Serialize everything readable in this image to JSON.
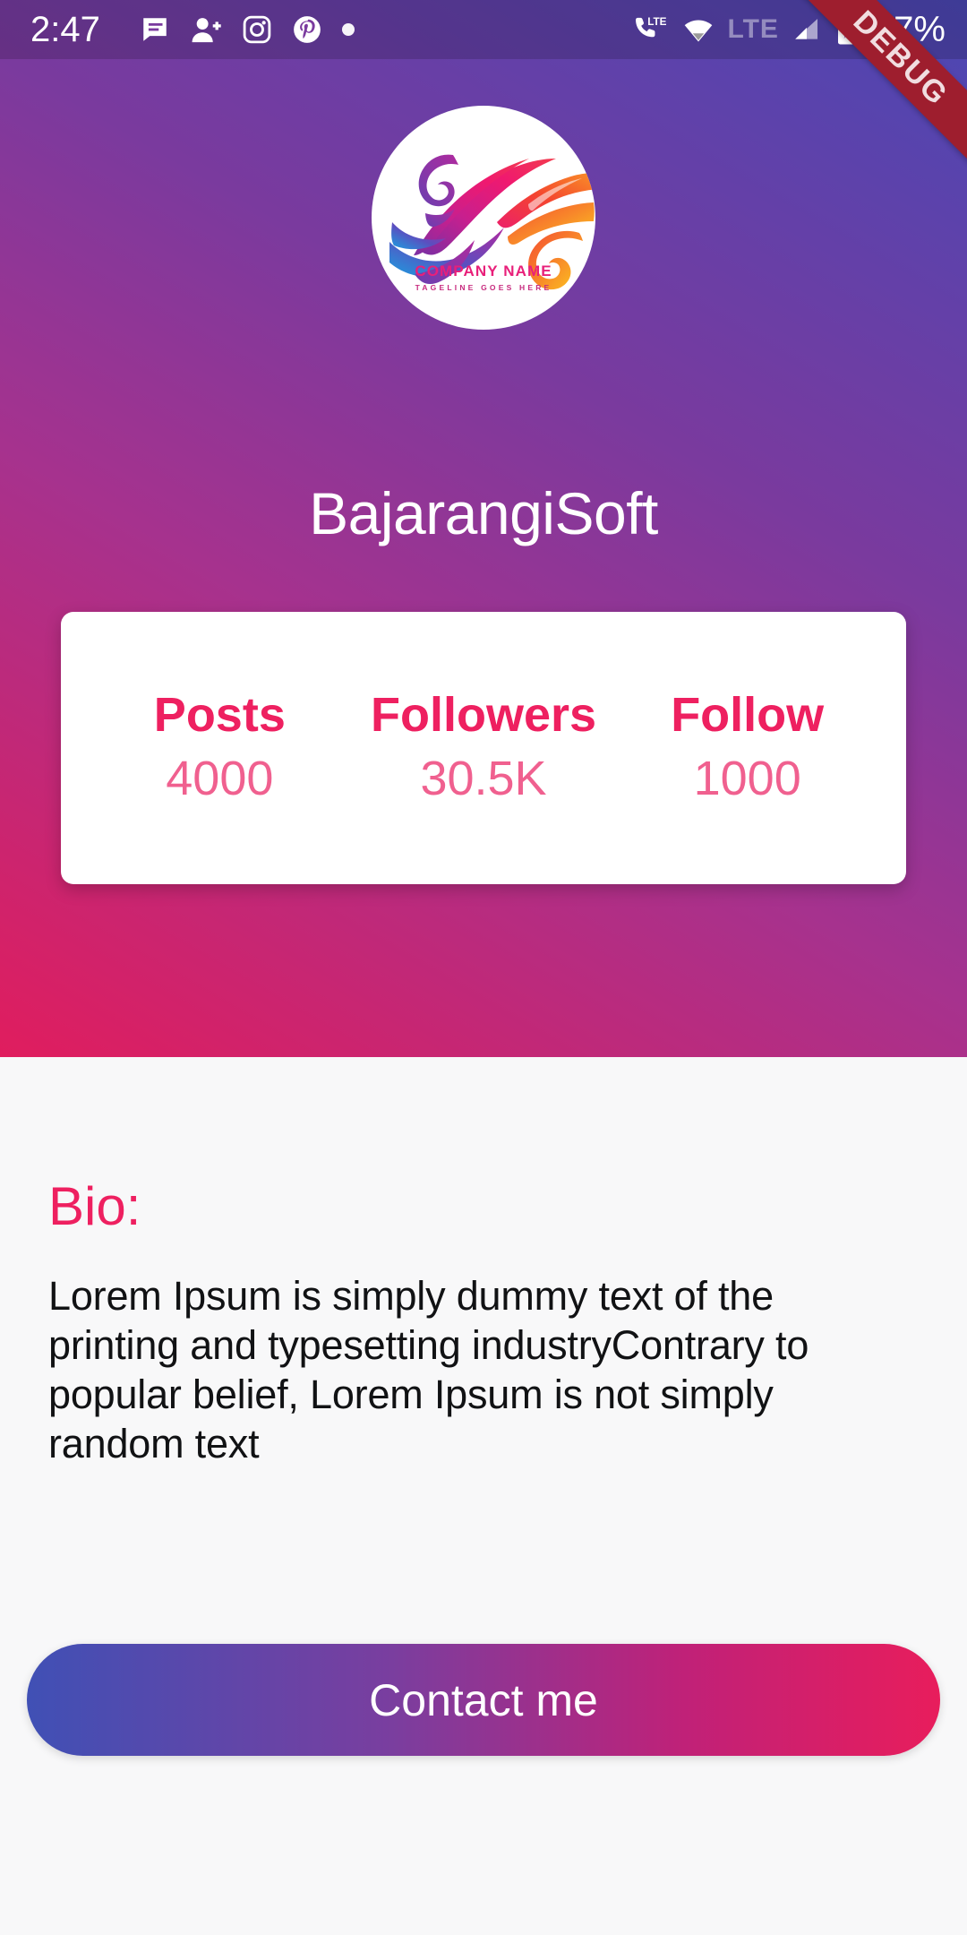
{
  "status_bar": {
    "time": "2:47",
    "battery_percent": "97%",
    "left_icons": [
      "message-icon",
      "person-add-icon",
      "instagram-icon",
      "pinterest-icon",
      "dot-icon"
    ],
    "right_icons": [
      "phone-lte-icon",
      "wifi-icon",
      "lte-label-icon",
      "signal-icon",
      "battery-charging-icon"
    ],
    "lte_label": "LTE",
    "call_lte_label": "LTE"
  },
  "debug_banner": {
    "label": "DEBUG",
    "color": "#9e1e2e"
  },
  "header": {
    "gradient_from": "#4b47b3",
    "gradient_to": "#e01d5e",
    "profile_name": "BajarangiSoft",
    "logo": {
      "company_name": "COMPANY NAME",
      "tagline": "TAGELINE GOES HERE",
      "accent_color": "#e8207a"
    }
  },
  "stats": {
    "accent_label_color": "#ee2060",
    "accent_value_color": "#f0608f",
    "items": [
      {
        "label": "Posts",
        "value": "4000"
      },
      {
        "label": "Followers",
        "value": "30.5K"
      },
      {
        "label": "Follow",
        "value": "1000"
      }
    ]
  },
  "bio": {
    "title": "Bio:",
    "title_color": "#ee2060",
    "text": "Lorem Ipsum is simply dummy text of the printing and typesetting industryContrary to popular belief, Lorem Ipsum is not simply random text"
  },
  "contact": {
    "label": "Contact me",
    "gradient_from": "#4050b5",
    "gradient_to": "#e81d5c"
  }
}
